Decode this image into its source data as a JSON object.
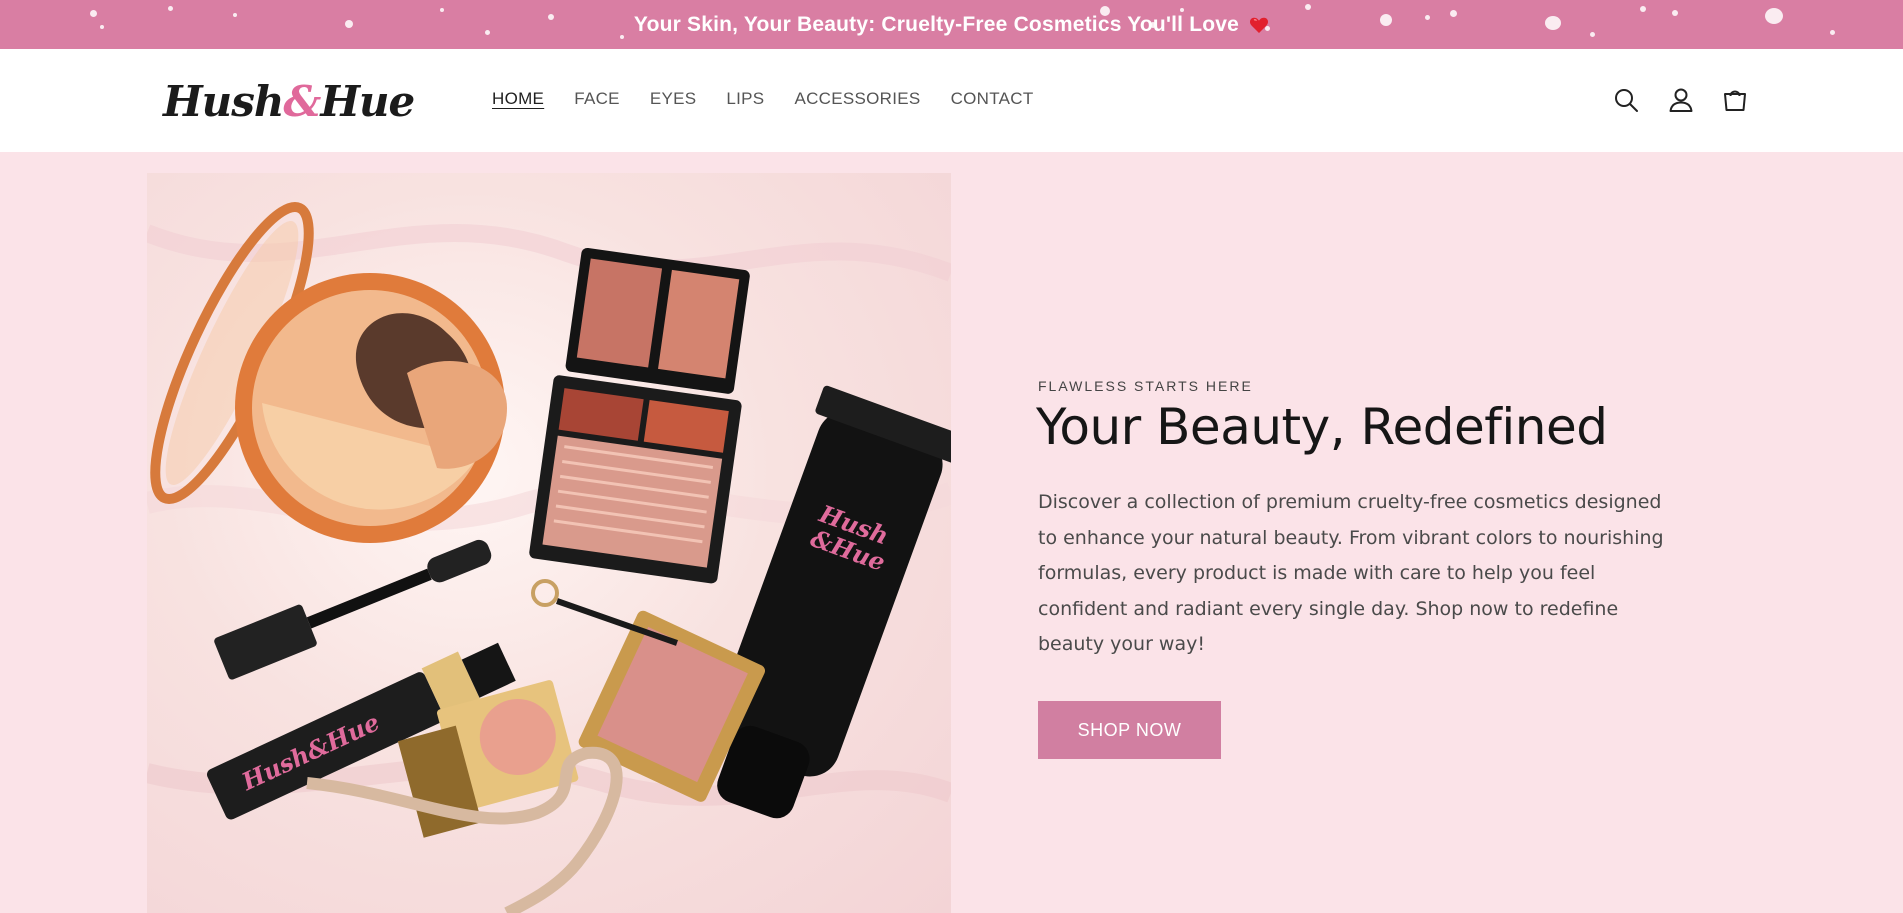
{
  "announcement": {
    "text": "Your Skin, Your Beauty: Cruelty-Free Cosmetics You'll Love",
    "icon": "heart-icon",
    "background_color": "#d97ea3"
  },
  "header": {
    "logo": {
      "part1": "Hush",
      "amp": "&",
      "part2": "Hue"
    },
    "nav": [
      {
        "label": "HOME",
        "active": true
      },
      {
        "label": "FACE"
      },
      {
        "label": "EYES"
      },
      {
        "label": "LIPS"
      },
      {
        "label": "ACCESSORIES"
      },
      {
        "label": "CONTACT"
      }
    ],
    "icons": [
      "search-icon",
      "account-icon",
      "cart-icon"
    ]
  },
  "hero": {
    "image_alt": "Hush&Hue makeup products arranged on a pink silk background",
    "product_brand": {
      "part1": "Hush",
      "amp": "&",
      "part2": "Hue"
    },
    "eyebrow": "FLAWLESS STARTS HERE",
    "headline": "Your Beauty, Redefined",
    "body": "Discover a collection of premium cruelty-free cosmetics designed to enhance your natural beauty. From vibrant colors to nourishing formulas, every product is made with care to help you feel confident and radiant every single day. Shop now to redefine beauty your way!",
    "cta_label": "SHOP NOW"
  },
  "colors": {
    "page_background": "#fbe3e8",
    "accent_pink": "#d17fa1",
    "logo_pink": "#e0699b"
  }
}
